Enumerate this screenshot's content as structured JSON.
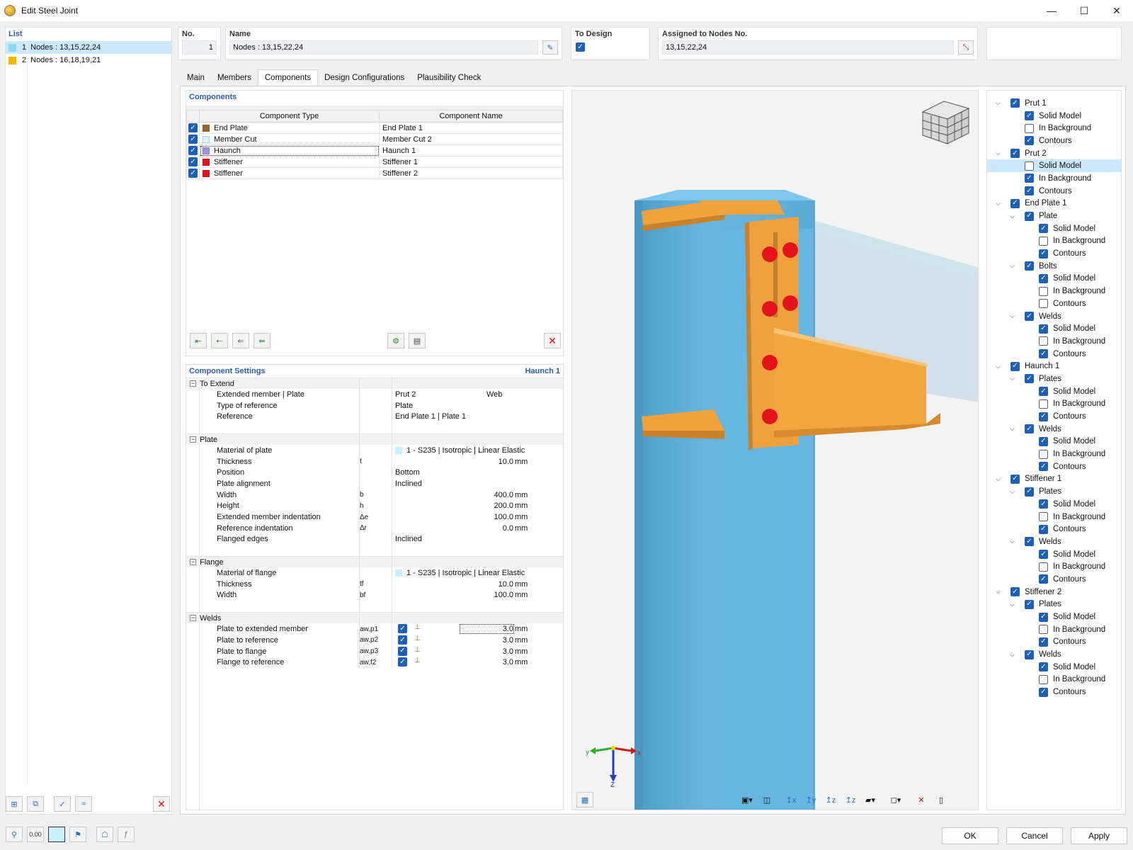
{
  "window": {
    "title": "Edit Steel Joint",
    "minimize": "—",
    "maximize": "☐",
    "close": "✕"
  },
  "list": {
    "header": "List",
    "items": [
      {
        "num": "1",
        "label": "Nodes : 13,15,22,24",
        "color": "#8dd7f5",
        "selected": true
      },
      {
        "num": "2",
        "label": "Nodes : 16,18,19,21",
        "color": "#f2b800",
        "selected": false
      }
    ]
  },
  "fields": {
    "no_label": "No.",
    "no_value": "1",
    "name_label": "Name",
    "name_value": "Nodes : 13,15,22,24",
    "todesign_label": "To Design",
    "assigned_label": "Assigned to Nodes No.",
    "assigned_value": "13,15,22,24"
  },
  "tabs": [
    "Main",
    "Members",
    "Components",
    "Design Configurations",
    "Plausibility Check"
  ],
  "active_tab": "Components",
  "components": {
    "header": "Components",
    "col_type": "Component Type",
    "col_name": "Component Name",
    "rows": [
      {
        "type": "End Plate",
        "name": "End Plate 1",
        "color": "#9b6a2f"
      },
      {
        "type": "Member Cut",
        "name": "Member Cut 2",
        "color": "#d9f6ff"
      },
      {
        "type": "Haunch",
        "name": "Haunch 1",
        "color": "#9d93e6"
      },
      {
        "type": "Stiffener",
        "name": "Stiffener 1",
        "color": "#e8141c"
      },
      {
        "type": "Stiffener",
        "name": "Stiffener 2",
        "color": "#e8141c"
      }
    ]
  },
  "settings": {
    "header": "Component Settings",
    "current": "Haunch 1",
    "to_extend": {
      "title": "To Extend",
      "extended_member_label": "Extended member | Plate",
      "extended_member_v1": "Prut 2",
      "extended_member_v2": "Web",
      "type_ref_label": "Type of reference",
      "type_ref_value": "Plate",
      "reference_label": "Reference",
      "reference_value": "End Plate 1 | Plate 1"
    },
    "plate": {
      "title": "Plate",
      "material_label": "Material of plate",
      "material_value": "1 - S235 | Isotropic | Linear Elastic",
      "thickness_label": "Thickness",
      "thickness_sym": "t",
      "thickness_value": "10.0",
      "thickness_unit": "mm",
      "position_label": "Position",
      "position_value": "Bottom",
      "alignment_label": "Plate alignment",
      "alignment_value": "Inclined",
      "width_label": "Width",
      "width_sym": "b",
      "width_value": "400.0",
      "width_unit": "mm",
      "height_label": "Height",
      "height_sym": "h",
      "height_value": "200.0",
      "height_unit": "mm",
      "ext_indent_label": "Extended member indentation",
      "ext_indent_sym": "Δe",
      "ext_indent_value": "100.0",
      "ext_indent_unit": "mm",
      "ref_indent_label": "Reference indentation",
      "ref_indent_sym": "Δr",
      "ref_indent_value": "0.0",
      "ref_indent_unit": "mm",
      "flanged_label": "Flanged edges",
      "flanged_value": "Inclined"
    },
    "flange": {
      "title": "Flange",
      "material_label": "Material of flange",
      "material_value": "1 - S235 | Isotropic | Linear Elastic",
      "thickness_label": "Thickness",
      "thickness_sym": "tf",
      "thickness_value": "10.0",
      "thickness_unit": "mm",
      "width_label": "Width",
      "width_sym": "bf",
      "width_value": "100.0",
      "width_unit": "mm"
    },
    "welds": {
      "title": "Welds",
      "rows": [
        {
          "label": "Plate to extended member",
          "sym": "aw,p1",
          "value": "3.0",
          "unit": "mm"
        },
        {
          "label": "Plate to reference",
          "sym": "aw,p2",
          "value": "3.0",
          "unit": "mm"
        },
        {
          "label": "Plate to flange",
          "sym": "aw,p3",
          "value": "3.0",
          "unit": "mm"
        },
        {
          "label": "Flange to reference",
          "sym": "aw,f2",
          "value": "3.0",
          "unit": "mm"
        }
      ]
    }
  },
  "axes": {
    "x": "x",
    "y": "y",
    "z": "Z"
  },
  "tree": [
    {
      "d": 0,
      "label": "Prut 1",
      "chev": true,
      "on": true
    },
    {
      "d": 1,
      "label": "Solid Model",
      "on": true
    },
    {
      "d": 1,
      "label": "In Background",
      "on": false
    },
    {
      "d": 1,
      "label": "Contours",
      "on": true
    },
    {
      "d": 0,
      "label": "Prut 2",
      "chev": true,
      "on": true
    },
    {
      "d": 1,
      "label": "Solid Model",
      "on": false,
      "hl": true
    },
    {
      "d": 1,
      "label": "In Background",
      "on": true
    },
    {
      "d": 1,
      "label": "Contours",
      "on": true
    },
    {
      "d": 0,
      "label": "End Plate 1",
      "chev": true,
      "on": true
    },
    {
      "d": 1,
      "label": "Plate",
      "chev": true,
      "on": true
    },
    {
      "d": 2,
      "label": "Solid Model",
      "on": true
    },
    {
      "d": 2,
      "label": "In Background",
      "on": false
    },
    {
      "d": 2,
      "label": "Contours",
      "on": true
    },
    {
      "d": 1,
      "label": "Bolts",
      "chev": true,
      "on": true
    },
    {
      "d": 2,
      "label": "Solid Model",
      "on": true
    },
    {
      "d": 2,
      "label": "In Background",
      "on": false
    },
    {
      "d": 2,
      "label": "Contours",
      "on": false
    },
    {
      "d": 1,
      "label": "Welds",
      "chev": true,
      "on": true
    },
    {
      "d": 2,
      "label": "Solid Model",
      "on": true
    },
    {
      "d": 2,
      "label": "In Background",
      "on": false
    },
    {
      "d": 2,
      "label": "Contours",
      "on": true
    },
    {
      "d": 0,
      "label": "Haunch 1",
      "chev": true,
      "on": true
    },
    {
      "d": 1,
      "label": "Plates",
      "chev": true,
      "on": true
    },
    {
      "d": 2,
      "label": "Solid Model",
      "on": true
    },
    {
      "d": 2,
      "label": "In Background",
      "on": false
    },
    {
      "d": 2,
      "label": "Contours",
      "on": true
    },
    {
      "d": 1,
      "label": "Welds",
      "chev": true,
      "on": true
    },
    {
      "d": 2,
      "label": "Solid Model",
      "on": true
    },
    {
      "d": 2,
      "label": "In Background",
      "on": false
    },
    {
      "d": 2,
      "label": "Contours",
      "on": true
    },
    {
      "d": 0,
      "label": "Stiffener 1",
      "chev": true,
      "on": true
    },
    {
      "d": 1,
      "label": "Plates",
      "chev": true,
      "on": true
    },
    {
      "d": 2,
      "label": "Solid Model",
      "on": true
    },
    {
      "d": 2,
      "label": "In Background",
      "on": false
    },
    {
      "d": 2,
      "label": "Contours",
      "on": true
    },
    {
      "d": 1,
      "label": "Welds",
      "chev": true,
      "on": true
    },
    {
      "d": 2,
      "label": "Solid Model",
      "on": true
    },
    {
      "d": 2,
      "label": "In Background",
      "on": false
    },
    {
      "d": 2,
      "label": "Contours",
      "on": true
    },
    {
      "d": 0,
      "label": "Stiffener 2",
      "chev": true,
      "on": true
    },
    {
      "d": 1,
      "label": "Plates",
      "chev": true,
      "on": true
    },
    {
      "d": 2,
      "label": "Solid Model",
      "on": true
    },
    {
      "d": 2,
      "label": "In Background",
      "on": false
    },
    {
      "d": 2,
      "label": "Contours",
      "on": true
    },
    {
      "d": 1,
      "label": "Welds",
      "chev": true,
      "on": true
    },
    {
      "d": 2,
      "label": "Solid Model",
      "on": true
    },
    {
      "d": 2,
      "label": "In Background",
      "on": false
    },
    {
      "d": 2,
      "label": "Contours",
      "on": true
    }
  ],
  "footer": {
    "ok": "OK",
    "cancel": "Cancel",
    "apply": "Apply",
    "units_value": "0.00"
  },
  "colors": {
    "accent": "#2b5ea8",
    "steel_blue": "#66b9e3",
    "plate_orange": "#f2a23a",
    "bolt_red": "#e3121b"
  }
}
